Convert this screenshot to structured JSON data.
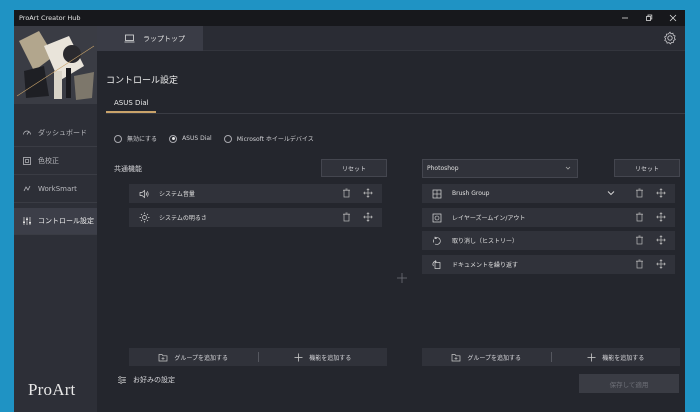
{
  "window": {
    "title": "ProArt Creator Hub"
  },
  "sidebar": {
    "items": [
      {
        "label": "ダッシュボード",
        "icon": "dashboard-icon"
      },
      {
        "label": "色校正",
        "icon": "color-calibration-icon"
      },
      {
        "label": "WorkSmart",
        "icon": "worksmart-icon"
      },
      {
        "label": "コントロール設定",
        "icon": "sliders-icon",
        "active": true
      }
    ],
    "brand": "ProArt"
  },
  "topbar": {
    "tab_label": "ラップトップ"
  },
  "page": {
    "title": "コントロール設定",
    "subtab": "ASUS Dial"
  },
  "mode": {
    "options": [
      "無効にする",
      "ASUS Dial",
      "Microsoft ホイールデバイス"
    ],
    "selected": "ASUS Dial"
  },
  "left_panel": {
    "label": "共通機能",
    "reset_label": "リセット",
    "rows": [
      {
        "label": "システム音量",
        "icon": "speaker-icon"
      },
      {
        "label": "システムの明るさ",
        "icon": "brightness-icon"
      }
    ],
    "add_group": "グループを追加する",
    "add_function": "機能を追加する"
  },
  "right_panel": {
    "app_select": "Photoshop",
    "reset_label": "リセット",
    "rows": [
      {
        "label": "Brush Group",
        "icon": "brush-group-icon",
        "expandable": true
      },
      {
        "label": "レイヤーズームイン/アウト",
        "icon": "layer-zoom-icon"
      },
      {
        "label": "取り消し（ヒストリー）",
        "icon": "undo-history-icon"
      },
      {
        "label": "ドキュメントを繰り返す",
        "icon": "document-cycle-icon"
      }
    ],
    "add_group": "グループを追加する",
    "add_function": "機能を追加する"
  },
  "footer": {
    "preferences": "お好みの設定",
    "save_apply": "保存して適用"
  },
  "colors": {
    "accent": "#c9a36a",
    "background": "#24262d",
    "sidebar": "#2d2f37",
    "desktop": "#1f93c4"
  }
}
